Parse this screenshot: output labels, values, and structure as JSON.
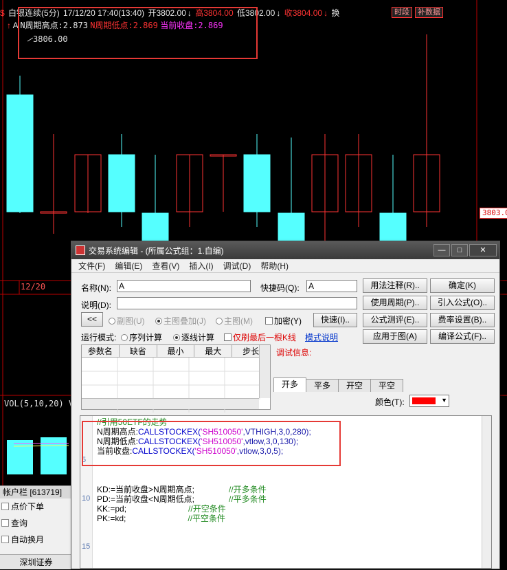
{
  "header": {
    "icon": "$",
    "title": "白银连续(5分)",
    "datetime": "17/12/20 17:40(13:40)",
    "open": "开3802.00",
    "open_arrow": "↓",
    "high": "高3804.00",
    "low": "低3802.00",
    "low_arrow": "↓",
    "close": "收3804.00",
    "close_arrow": "↓",
    "extra": "换",
    "btn_period": "时段",
    "btn_fill": "补数据"
  },
  "indicator_line": {
    "arrow": "↑",
    "name": "A",
    "n_high": "N周期高点:2.873",
    "n_low": "N周期低点:2.869",
    "cur_close": "当前收盘:2.869"
  },
  "chart": {
    "peak_label": "3806.00",
    "price_tag": "3803.0",
    "date_label": "12/20",
    "vol_label": "VOL(5,10,20)",
    "vol_extra": "V"
  },
  "account": {
    "title": "帐户栏 [613719]",
    "items": [
      "点价下单",
      "查询",
      "自动换月"
    ],
    "broker": "深圳证券"
  },
  "dialog": {
    "title": "交易系统编辑 - (所属公式组：1.自编)",
    "menu": [
      "文件(F)",
      "编辑(E)",
      "查看(V)",
      "插入(I)",
      "调试(D)",
      "帮助(H)"
    ],
    "name_label": "名称(N):",
    "name_value": "A",
    "hotkey_label": "快捷码(Q):",
    "hotkey_value": "A",
    "desc_label": "说明(D):",
    "desc_value": "",
    "collapse": "<<",
    "radio_sub": "副图(U)",
    "radio_overlay": "主图叠加(J)",
    "radio_main": "主图(M)",
    "chk_encrypt": "加密(Y)",
    "btn_speed": "快速(I)..",
    "run_mode_label": "运行模式:",
    "run_seq": "序列计算",
    "run_step": "逐线计算",
    "chk_last": "仅刷最后一根K线",
    "mode_help": "模式说明",
    "debug_label": "调试信息:",
    "buttons": {
      "usage": "用法注释(R)..",
      "ok": "确定(K)",
      "period": "使用周期(P)..",
      "import": "引入公式(O)..",
      "test": "公式测评(E)..",
      "rate": "费率设置(B)..",
      "apply": "应用于图(A)",
      "compile": "编译公式(F)..",
      "win_min": "—",
      "win_max": "□",
      "win_close": "✕"
    },
    "param_cols": [
      "参数名",
      "缺省",
      "最小",
      "最大",
      "步长"
    ],
    "tabs": [
      "开多",
      "平多",
      "开空",
      "平空"
    ],
    "color_label": "颜色(T):",
    "color_value": "#ff0000"
  },
  "code": {
    "lines": [
      {
        "n": "",
        "text": "//引用50ETF的走势"
      },
      {
        "n": "",
        "a": "N周期高点:",
        "b": "CALLSTOCKEX(",
        "c": "'SH510050'",
        "d": ",VTHIGH,3,0,280);"
      },
      {
        "n": "",
        "a": "N周期低点:",
        "b": "CALLSTOCKEX(",
        "c": "'SH510050'",
        "d": ",vtlow,3,0,130);"
      },
      {
        "n": "",
        "a": "当前收盘:",
        "b": "CALLSTOCKEX(",
        "c": "'SH510050'",
        "d": ",vtlow,3,0,5);"
      },
      {
        "n": "5"
      },
      {
        "n": ""
      },
      {
        "n": ""
      },
      {
        "n": "",
        "a": "KD:=当前收盘>N周期高点;",
        "cmt": "//开多条件"
      },
      {
        "n": "10",
        "a": "PD:=当前收盘<N周期低点;",
        "cmt": "//平多条件"
      },
      {
        "n": "",
        "a": "KK:=pd;",
        "cmt": "//开空条件"
      },
      {
        "n": "",
        "a": "PK:=kd;",
        "cmt": "//平空条件"
      },
      {
        "n": ""
      },
      {
        "n": ""
      },
      {
        "n": "15"
      }
    ]
  }
}
